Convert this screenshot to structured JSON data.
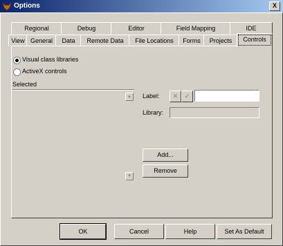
{
  "window": {
    "title": "Options",
    "close_label": "X"
  },
  "tabs_row1": [
    "Regional",
    "Debug",
    "Editor",
    "Field Mapping",
    "IDE"
  ],
  "tabs_row2": [
    "View",
    "General",
    "Data",
    "Remote Data",
    "File Locations",
    "Forms",
    "Projects",
    "Controls"
  ],
  "controls": {
    "radio1": "Visual class libraries",
    "radio2": "ActiveX controls",
    "selected_label": "Selected",
    "label_label": "Label:",
    "library_label": "Library:",
    "add_button": "Add...",
    "remove_button": "Remove",
    "cancel_glyph": "✕",
    "accept_glyph": "✓"
  },
  "footer": {
    "ok": "OK",
    "cancel": "Cancel",
    "help": "Help",
    "set_default": "Set As Default"
  }
}
